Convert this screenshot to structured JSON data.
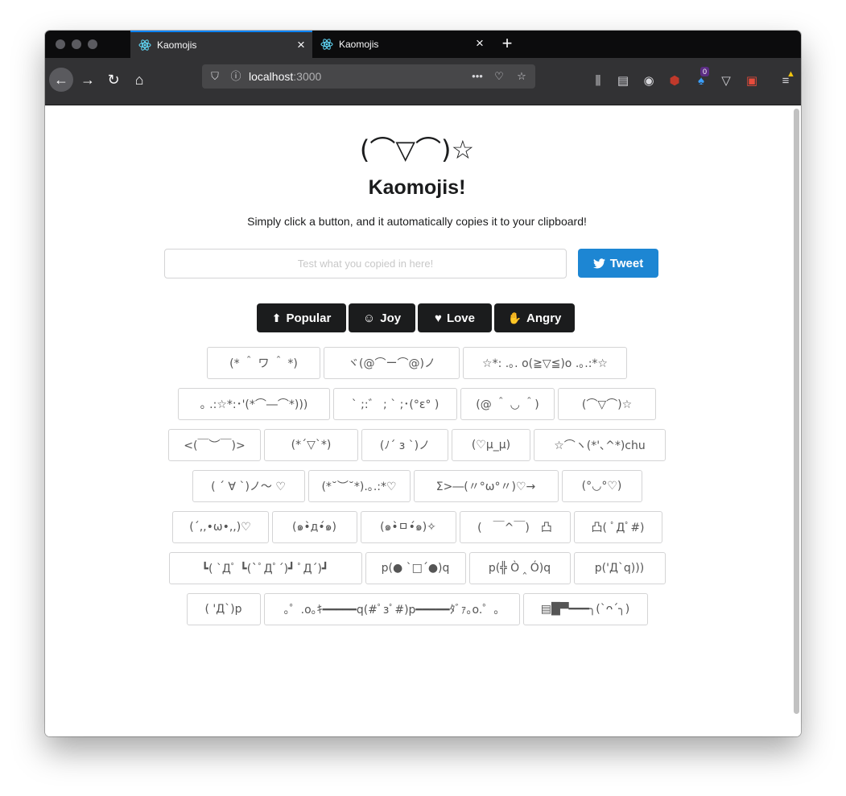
{
  "browser": {
    "tabs": [
      {
        "title": "Kaomojis",
        "active": true
      },
      {
        "title": "Kaomojis",
        "active": false
      }
    ],
    "url_host": "localhost",
    "url_port": ":3000",
    "badge_count": "0"
  },
  "page": {
    "hero": "(⌒▽⌒)☆",
    "title": "Kaomojis!",
    "subtitle": "Simply click a button, and it automatically copies it to your clipboard!",
    "input_placeholder": "Test what you copied in here!",
    "tweet_label": "Tweet",
    "categories": [
      "Popular",
      "Joy",
      "Love",
      "Angry"
    ]
  },
  "kaomoji_rows": [
    [
      "(* ＾ ワ ＾ *)",
      "ヾ(@⌒ー⌒@)ノ",
      "☆*: .｡. o(≧▽≦)o .｡.:*☆"
    ],
    [
      "｡ .:☆*:･'(*⌒―⌒*)))",
      "` ;:゛ ; ` ;･(°ε° )",
      "(@ ＾ ◡ ＾)",
      "(⌒▽⌒)☆"
    ],
    [
      "<(￣︶￣)>",
      "(*´▽`*)",
      "(ﾉ´ з `)ノ",
      "(♡μ_μ)",
      "☆⌒ヽ(*'､^*)chu"
    ],
    [
      "( ´ ∀ `)ノ～ ♡",
      "(*˘︶˘*).｡.:*♡",
      "Σ>―(〃°ω°〃)♡→",
      "(°◡°♡)"
    ],
    [
      "(´,,•ω•,,)♡",
      "(๑•̀д•́๑)",
      "(๑•̀ㅁ•́๑)✧",
      "(　￣^￣)　凸",
      "凸( ﾟДﾟ#)"
    ],
    [
      "┗( `Дﾟ ┗(`ﾟДﾟ´)┛ ﾟД´)┛",
      "p(● `□´●)q",
      "p(╬ Ò ‸ Ó)q",
      "p('Д`q)))"
    ],
    [
      "( 'Д`)p",
      "｡゜.o｡ｷ━━━━━q(#ﾟзﾟ#)p━━━━━ﾀﾞｧ｡o.゜｡",
      "▤█▀━━━╮(`ᴖ´╮)"
    ]
  ]
}
